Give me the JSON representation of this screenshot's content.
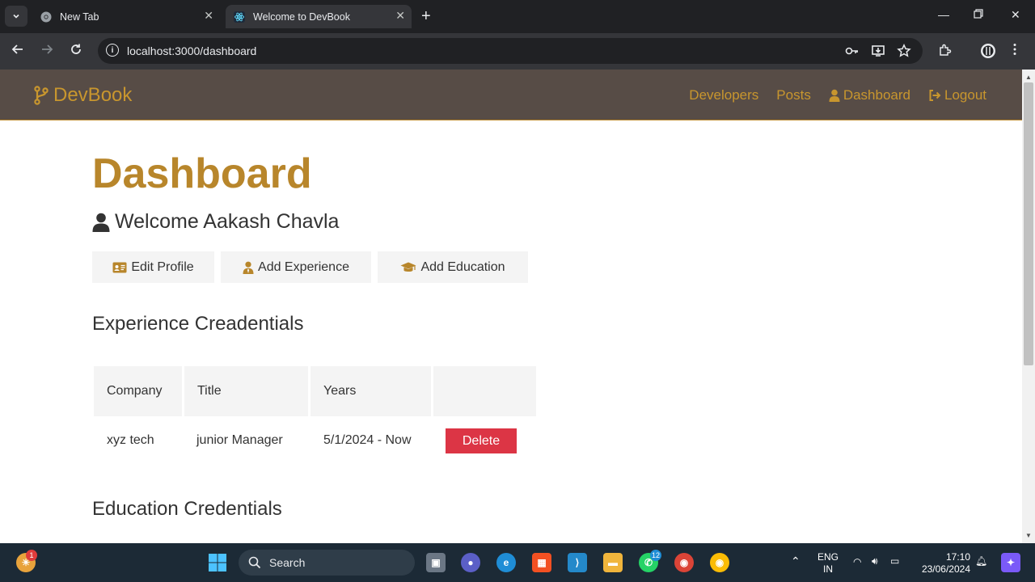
{
  "browser": {
    "tabs": [
      {
        "title": "New Tab"
      },
      {
        "title": "Welcome to DevBook"
      }
    ],
    "url": "localhost:3000/dashboard"
  },
  "navbar": {
    "brand": "DevBook",
    "links": {
      "developers": "Developers",
      "posts": "Posts",
      "dashboard": "Dashboard",
      "logout": "Logout"
    }
  },
  "page": {
    "title": "Dashboard",
    "welcome": "Welcome Aakash Chavla",
    "buttons": {
      "edit_profile": "Edit Profile",
      "add_experience": "Add Experience",
      "add_education": "Add Education"
    },
    "experience": {
      "heading": "Experience Creadentials",
      "headers": [
        "Company",
        "Title",
        "Years",
        ""
      ],
      "rows": [
        {
          "company": "xyz tech",
          "title": "junior Manager",
          "years": "5/1/2024 - Now",
          "action": "Delete"
        }
      ]
    },
    "education": {
      "heading": "Education Credentials"
    }
  },
  "colors": {
    "brand": "#c8962e",
    "heading": "#b8862b",
    "navbar_bg": "#574c46",
    "danger": "#dc3545"
  },
  "taskbar": {
    "search_label": "Search",
    "store_badge": "1",
    "whatsapp_badge": "12",
    "lang_top": "ENG",
    "lang_bottom": "IN",
    "time": "17:10",
    "date": "23/06/2024"
  }
}
